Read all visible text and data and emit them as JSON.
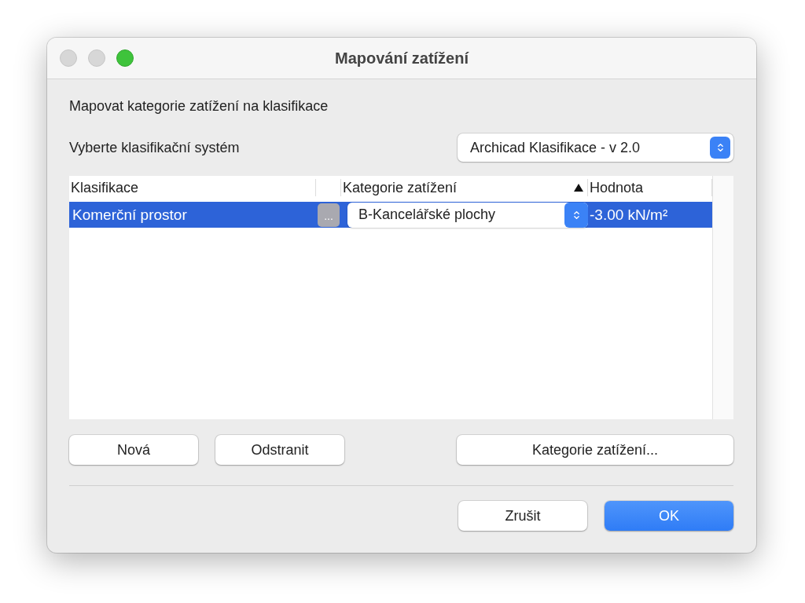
{
  "window": {
    "title": "Mapování zatížení"
  },
  "instruction": "Mapovat kategorie zatížení na klasifikace",
  "classification_system": {
    "label": "Vyberte klasifikační systém",
    "value": "Archicad Klasifikace - v 2.0"
  },
  "table": {
    "columns": [
      {
        "label": "Klasifikace",
        "sorted": false
      },
      {
        "label": "Kategorie zatížení",
        "sorted": true
      },
      {
        "label": "Hodnota",
        "sorted": false
      }
    ],
    "rows": [
      {
        "classification": "Komerční prostor",
        "more_button": "...",
        "load_category": "B-Kancelářské plochy",
        "value": "-3.00 kN/m²",
        "selected": true
      }
    ]
  },
  "table_buttons": [
    {
      "label": "Nová",
      "kind": "left"
    },
    {
      "label": "Odstranit",
      "kind": "left"
    },
    {
      "label": "Kategorie zatížení...",
      "kind": "right"
    }
  ],
  "footer_buttons": [
    {
      "label": "Zrušit",
      "default": false
    },
    {
      "label": "OK",
      "default": true
    }
  ]
}
